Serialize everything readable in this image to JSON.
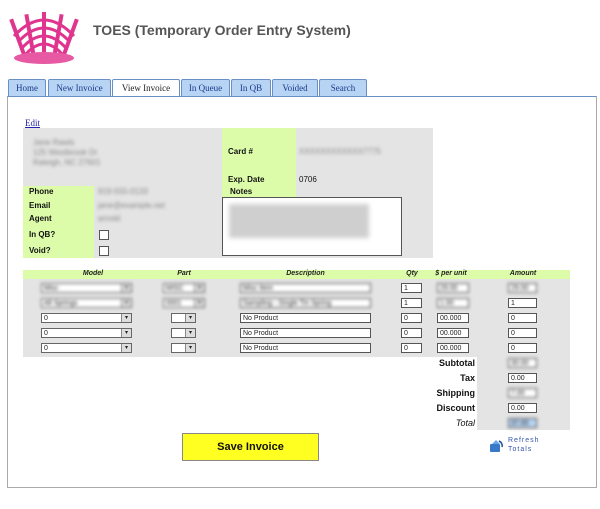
{
  "header": {
    "title": "TOES (Temporary Order Entry System)"
  },
  "tabs": [
    {
      "label": "Home"
    },
    {
      "label": "New Invoice"
    },
    {
      "label": "View Invoice",
      "active": true
    },
    {
      "label": "In Queue"
    },
    {
      "label": "In QB"
    },
    {
      "label": "Voided"
    },
    {
      "label": "Search"
    }
  ],
  "edit_link": "Edit",
  "customer": {
    "address_lines": [
      "Jane Rawls",
      "125 Westbrook Dr",
      "Raleigh, NC 27601"
    ],
    "phone_label": "Phone",
    "phone_value": "919-555-0133",
    "email_label": "Email",
    "email_value": "jane@example.net",
    "agent_label": "Agent",
    "agent_value": "arnold",
    "inqb_label": "In QB?",
    "void_label": "Void?"
  },
  "card": {
    "card_label": "Card #",
    "card_value": "XXXXXXXXXXXX7775",
    "exp_label": "Exp. Date",
    "exp_value": "0706",
    "notes_label": "Notes"
  },
  "line_items": {
    "headers": {
      "model": "Model",
      "part": "Part",
      "description": "Description",
      "qty": "Qty",
      "price": "$ per unit",
      "amount": "Amount"
    },
    "rows": [
      {
        "model": "Misc",
        "part": "MISC",
        "description": "Misc Item",
        "qty": "1",
        "price": "29.00",
        "amount": "29.00",
        "blurred": true
      },
      {
        "model": "All Springs",
        "part": "0001",
        "description": "Sampling - Single Tin Spring",
        "qty": "1",
        "price": "1.00",
        "amount": "1",
        "blurred": true
      },
      {
        "model": "0",
        "part": "",
        "description": "No Product",
        "qty": "0",
        "price": "00.000",
        "amount": "0",
        "blurred": false
      },
      {
        "model": "0",
        "part": "",
        "description": "No Product",
        "qty": "0",
        "price": "00.000",
        "amount": "0",
        "blurred": false
      },
      {
        "model": "0",
        "part": "",
        "description": "No Product",
        "qty": "0",
        "price": "00.000",
        "amount": "0",
        "blurred": false
      }
    ]
  },
  "totals": {
    "subtotal_label": "Subtotal",
    "subtotal_value": "30.00",
    "tax_label": "Tax",
    "tax_value": "0.00",
    "shipping_label": "Shipping",
    "shipping_value": "7.00",
    "discount_label": "Discount",
    "discount_value": "0.00",
    "total_label": "Total",
    "total_value": "37.00"
  },
  "actions": {
    "save_label": "Save Invoice",
    "refresh_label": "Refresh Totals",
    "refresh_line1": "Refresh",
    "refresh_line2": "Totals"
  },
  "colors": {
    "label_green": "#ddfcaa",
    "panel_grey": "#e4e4e4",
    "tab_blue": "#b8d4f4",
    "save_yellow": "#ffff22",
    "total_highlight": "#b8d4f4"
  }
}
